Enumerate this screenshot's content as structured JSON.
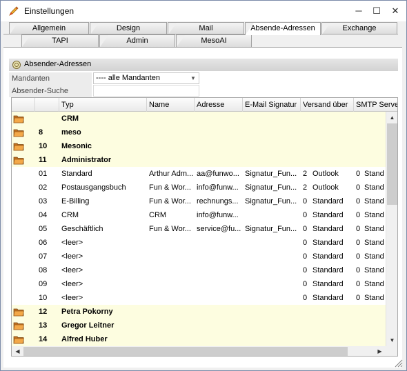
{
  "window": {
    "title": "Einstellungen",
    "min_glyph": "─",
    "max_glyph": "☐",
    "close_glyph": "✕"
  },
  "tabs_row1": [
    "Allgemein",
    "Design",
    "Mail",
    "Absende-Adressen",
    "Exchange"
  ],
  "tabs_row2": [
    "TAPI",
    "Admin",
    "MesoAI"
  ],
  "active_tab": "Absende-Adressen",
  "section": {
    "title": "Absender-Adressen"
  },
  "filters": {
    "mandanten_label": "Mandanten",
    "mandanten_value": "---- alle Mandanten",
    "search_label": "Absender-Suche",
    "search_value": ""
  },
  "grid": {
    "columns": [
      "",
      "",
      "Typ",
      "Name",
      "Adresse",
      "E-Mail Signatur",
      "Versand über",
      "SMTP Server"
    ],
    "rows": [
      {
        "group": true,
        "num": "",
        "typ": "CRM"
      },
      {
        "group": true,
        "num": "8",
        "typ": "meso"
      },
      {
        "group": true,
        "num": "10",
        "typ": "Mesonic"
      },
      {
        "group": true,
        "num": "11",
        "typ": "Administrator"
      },
      {
        "group": false,
        "num": "01",
        "typ": "Standard",
        "name": "Arthur Adm...",
        "adresse": "aa@funwo...",
        "signatur": "Signatur_Fun...",
        "versand_code": "2",
        "versand": "Outlook",
        "smtp_code": "0",
        "smtp": "Stand"
      },
      {
        "group": false,
        "num": "02",
        "typ": "Postausgangsbuch",
        "name": "Fun & Wor...",
        "adresse": "info@funw...",
        "signatur": "Signatur_Fun...",
        "versand_code": "2",
        "versand": "Outlook",
        "smtp_code": "0",
        "smtp": "Stand"
      },
      {
        "group": false,
        "num": "03",
        "typ": "E-Billing",
        "name": "Fun & Wor...",
        "adresse": "rechnungs...",
        "signatur": "Signatur_Fun...",
        "versand_code": "0",
        "versand": "Standard",
        "smtp_code": "0",
        "smtp": "Stand"
      },
      {
        "group": false,
        "num": "04",
        "typ": "CRM",
        "name": "CRM",
        "adresse": "info@funw...",
        "signatur": "",
        "versand_code": "0",
        "versand": "Standard",
        "smtp_code": "0",
        "smtp": "Stand"
      },
      {
        "group": false,
        "num": "05",
        "typ": "Geschäftlich",
        "name": "Fun & Wor...",
        "adresse": "service@fu...",
        "signatur": "Signatur_Fun...",
        "versand_code": "0",
        "versand": "Standard",
        "smtp_code": "0",
        "smtp": "Stand"
      },
      {
        "group": false,
        "num": "06",
        "typ": "<leer>",
        "name": "",
        "adresse": "",
        "signatur": "",
        "versand_code": "0",
        "versand": "Standard",
        "smtp_code": "0",
        "smtp": "Stand"
      },
      {
        "group": false,
        "num": "07",
        "typ": "<leer>",
        "name": "",
        "adresse": "",
        "signatur": "",
        "versand_code": "0",
        "versand": "Standard",
        "smtp_code": "0",
        "smtp": "Stand"
      },
      {
        "group": false,
        "num": "08",
        "typ": "<leer>",
        "name": "",
        "adresse": "",
        "signatur": "",
        "versand_code": "0",
        "versand": "Standard",
        "smtp_code": "0",
        "smtp": "Stand"
      },
      {
        "group": false,
        "num": "09",
        "typ": "<leer>",
        "name": "",
        "adresse": "",
        "signatur": "",
        "versand_code": "0",
        "versand": "Standard",
        "smtp_code": "0",
        "smtp": "Stand"
      },
      {
        "group": false,
        "num": "10",
        "typ": "<leer>",
        "name": "",
        "adresse": "",
        "signatur": "",
        "versand_code": "0",
        "versand": "Standard",
        "smtp_code": "0",
        "smtp": "Stand"
      },
      {
        "group": true,
        "num": "12",
        "typ": "Petra Pokorny"
      },
      {
        "group": true,
        "num": "13",
        "typ": "Gregor Leitner"
      },
      {
        "group": true,
        "num": "14",
        "typ": "Alfred Huber"
      }
    ]
  },
  "scroll": {
    "up": "▲",
    "down": "▼",
    "left": "◀",
    "right": "▶"
  },
  "dropdown_arrow": "▼",
  "icons": {
    "app": "pen-icon",
    "section": "link-icon",
    "group": "folder-icon"
  },
  "colors": {
    "group_row_bg": "#fdfde0",
    "folder": "#e8a040"
  }
}
